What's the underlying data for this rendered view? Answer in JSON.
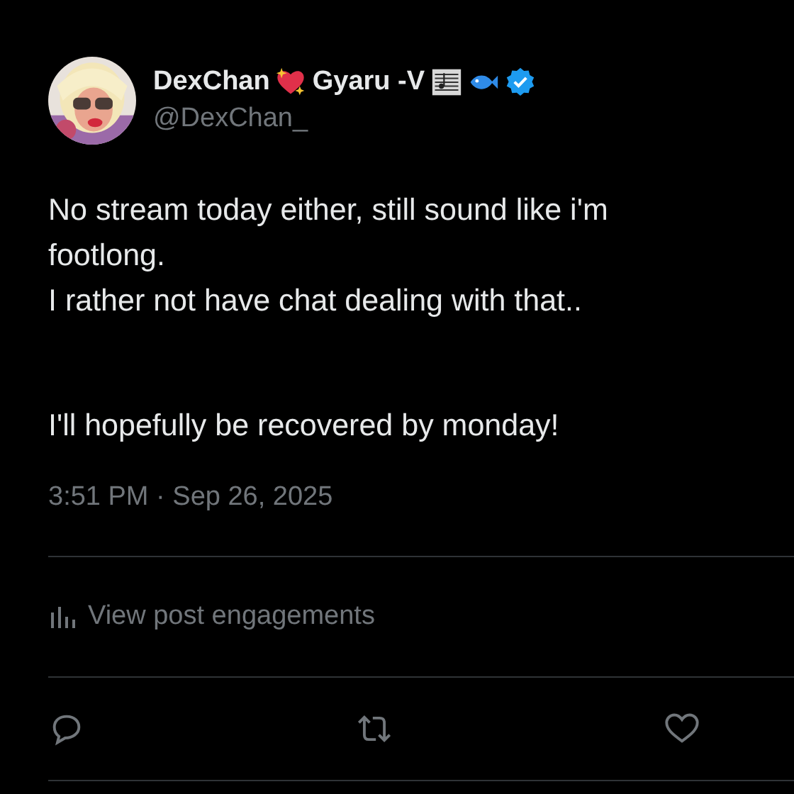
{
  "author": {
    "name_parts": [
      "DexChan",
      "Gyaru -V"
    ],
    "handle": "@DexChan_",
    "verified": true
  },
  "body": [
    "No stream today either, still sound like i'm\nfootlong.\nI rather not have chat dealing with that..",
    "I'll hopefully be recovered by monday!"
  ],
  "timestamp": "3:51 PM · Sep 26, 2025",
  "engagements_link": "View post engagements"
}
